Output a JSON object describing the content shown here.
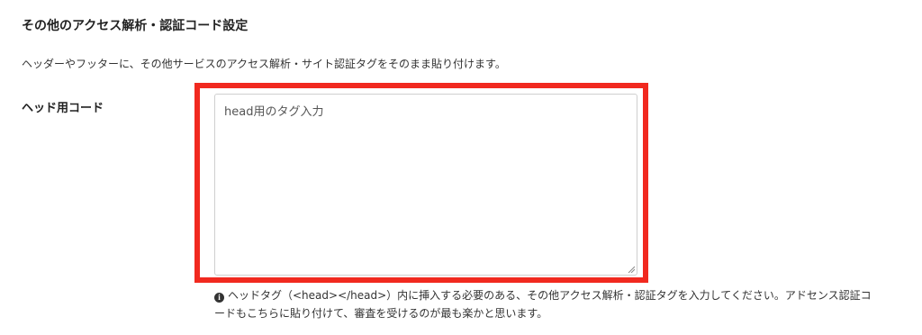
{
  "section": {
    "title": "その他のアクセス解析・認証コード設定",
    "description": "ヘッダーやフッターに、その他サービスのアクセス解析・サイト認証タグをそのまま貼り付けます。"
  },
  "head_code": {
    "label": "ヘッド用コード",
    "placeholder": "head用のタグ入力",
    "value": "",
    "help_icon": "info-circle-icon",
    "help_text": "ヘッドタグ（<head></head>）内に挿入する必要のある、その他アクセス解析・認証タグを入力してください。アドセンス認証コードもこちらに貼り付けて、審査を受けるのが最も楽かと思います。"
  },
  "colors": {
    "highlight": "#f1291f"
  }
}
